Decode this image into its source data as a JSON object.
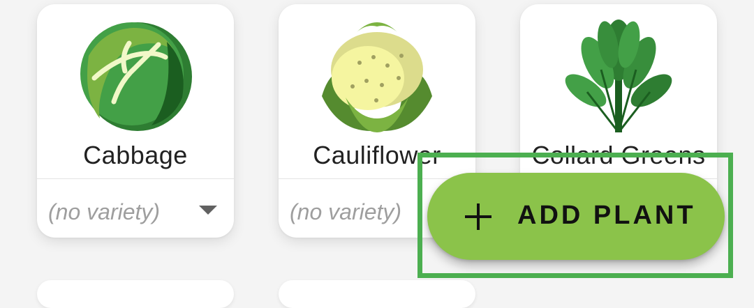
{
  "cards": [
    {
      "name": "Cabbage",
      "variety": "(no variety)",
      "icon": "cabbage-icon"
    },
    {
      "name": "Cauliflower",
      "variety": "(no variety)",
      "icon": "cauliflower-icon"
    },
    {
      "name": "Collard Greens",
      "variety": "",
      "icon": "collard-greens-icon"
    }
  ],
  "fab": {
    "label": "ADD PLANT",
    "icon": "plus-icon",
    "color": "#8bc34a"
  },
  "highlight_color": "#4caf50"
}
